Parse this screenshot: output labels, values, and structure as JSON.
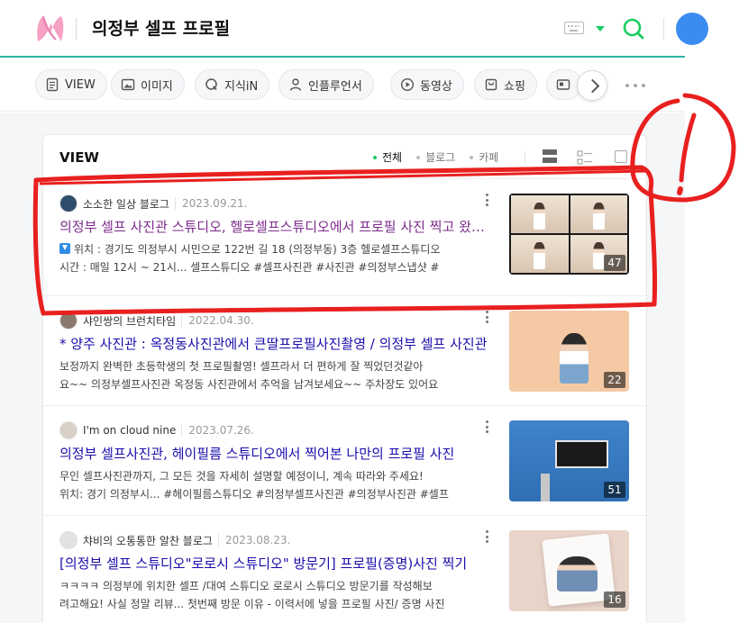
{
  "header": {
    "query": "의정부 셀프 프로필",
    "colors": {
      "accent": "#19ce60",
      "border": "#2db6a3"
    }
  },
  "tabs": [
    {
      "label": "VIEW",
      "icon": "document-icon"
    },
    {
      "label": "이미지",
      "icon": "image-icon"
    },
    {
      "label": "지식iN",
      "icon": "q-icon"
    },
    {
      "label": "인플루언서",
      "icon": "person-icon"
    },
    {
      "label": "동영상",
      "icon": "play-icon"
    },
    {
      "label": "쇼핑",
      "icon": "shopping-icon"
    }
  ],
  "panel": {
    "title": "VIEW",
    "filters": [
      "전체",
      "블로그",
      "카페"
    ],
    "active_filter": "전체"
  },
  "results": [
    {
      "author": "소소한 일상 블로그",
      "date": "2023.09.21.",
      "title": "의정부 셀프 사진관 스튜디오, 헬로셀프스튜디오에서 프로필 사진 찍고 왔어요",
      "visited": true,
      "snippet1": "위치 : 경기도 의정부시 시민으로 122번 길 18 (의정부동) 3층 헬로셀프스튜디오",
      "snippet2": "시간 : 매일 12시 ~ 21시... 셀프스튜디오 #셀프사진관 #사진관 #의정부스냅샷 #",
      "count": "47"
    },
    {
      "author": "샤인쌍의 브런치타임",
      "date": "2022.04.30.",
      "title": "* 양주 사진관 : 옥정동사진관에서 큰딸프로필사진촬영 / 의정부 셀프 사진관",
      "visited": false,
      "snippet1": "보정까지 완벽한 초등학생의 첫 프로필촬영! 셀프라서 더 편하게 잘 찍었던것같아",
      "snippet2": "요~~ 의정부셀프사진관 옥정동 사진관에서 추억을 남겨보세요~~ 주차장도 있어요",
      "count": "22"
    },
    {
      "author": "I'm on cloud nine",
      "date": "2023.07.26.",
      "title": "의정부 셀프사진관, 헤이필름 스튜디오에서 찍어본 나만의 프로필 사진",
      "visited": false,
      "snippet1": "무인 셀프사진관까지, 그 모든 것을 자세히 설명할 예정이니, 계속 따라와 주세요!",
      "snippet2": "위치: 경기 의정부시... #헤이필름스튜디오 #의정부셀프사진관 #의정부사진관 #셀프",
      "count": "51"
    },
    {
      "author": "챠비의 오통통한 알찬 블로그",
      "date": "2023.08.23.",
      "title": "[의정부 셀프 스튜디오\"로로시 스튜디오\" 방문기] 프로필(증명)사진 찍기",
      "visited": false,
      "snippet1": "ㅋㅋㅋㅋ 의정부에 위치한 셀프 /대여 스튜디오 로로시 스튜디오 방문기를 작성해보",
      "snippet2": "려고해요! 사실 정말 리뷰... 첫번째 방문 이유 - 이력서에 넣을 프로필 사진/ 증명 사진",
      "count": "16"
    }
  ]
}
